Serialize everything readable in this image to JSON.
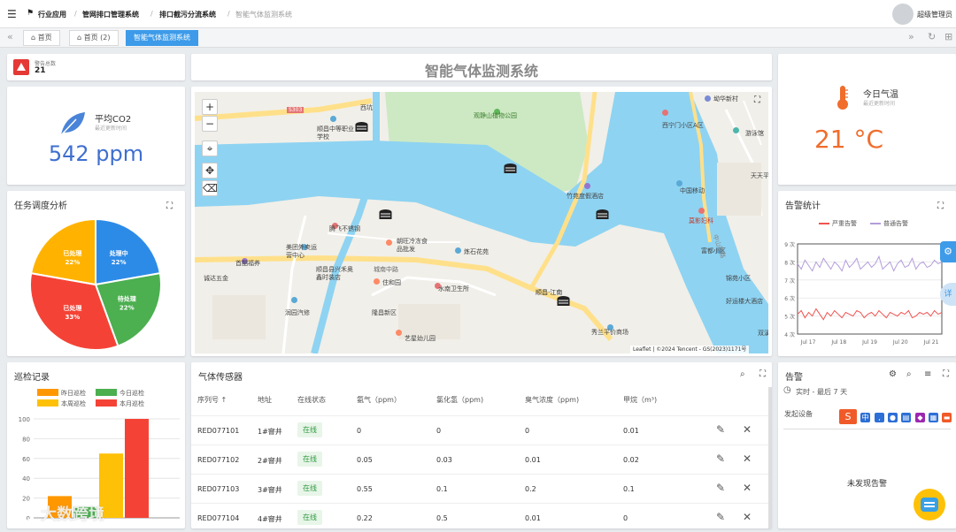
{
  "topbar": {
    "breadcrumb": [
      "行业应用",
      "管网排口管理系统",
      "排口截污分流系统",
      "智能气体监测系统"
    ],
    "user": "超级管理员"
  },
  "tabs": [
    {
      "label": "首页",
      "active": false
    },
    {
      "label": "首页 (2)",
      "active": false
    },
    {
      "label": "智能气体监测系统",
      "active": true
    }
  ],
  "page_title": "智能气体监测系统",
  "alarm_card": {
    "label": "警告总数",
    "value": "21"
  },
  "co2_card": {
    "title": "平均CO2",
    "subtitle": "最近更新时间",
    "value": "542 ppm"
  },
  "temp_card": {
    "title": "今日气温",
    "subtitle": "最近更新时间",
    "value": "21 °C"
  },
  "task_card": {
    "title": "任务调度分析"
  },
  "patrol_card": {
    "title": "巡检记录"
  },
  "map": {
    "attribution": "Leaflet | ©2024 Tencent - GS(2023)1171号",
    "labels": [
      "西坑",
      "坳华新村",
      "观静山植物公园",
      "西宁门小区A区",
      "游泳馆",
      "顺昌中等职业学校",
      "天天平",
      "竹苑度假酒店",
      "中国移动",
      "莫影妇科",
      "腾飞不锈钢",
      "朝旺冷冻食品批发",
      "美团外卖运营中心",
      "首酷福养",
      "城南中路",
      "炼石花苑",
      "顺昌县兴禾奥鑫时装店",
      "富都小区",
      "锦苑小区",
      "诚达五金",
      "住和园",
      "水南卫生所",
      "润园汽修",
      "隆昌新区",
      "好运楼大酒店",
      "艺星幼儿园",
      "秀兰平价商场",
      "双溪",
      "顺昌·江南",
      "中山西路",
      "S303"
    ]
  },
  "alarm_stats": {
    "title": "告警统计",
    "legend": [
      "严重告警",
      "普通告警"
    ]
  },
  "gas_sensor": {
    "title": "气体传感器",
    "columns": [
      "序列号",
      "地址",
      "在线状态",
      "氨气（ppm）",
      "氯化氢（ppm)",
      "臭气浓度（ppm)",
      "甲烷（m³)"
    ],
    "rows": [
      [
        "RED077101",
        "1#窨井",
        "在线",
        "0",
        "0",
        "0",
        "0.01"
      ],
      [
        "RED077102",
        "2#窨井",
        "在线",
        "0.05",
        "0.03",
        "0.01",
        "0.02"
      ],
      [
        "RED077103",
        "3#窨井",
        "在线",
        "0.55",
        "0.1",
        "0.2",
        "0.1"
      ],
      [
        "RED077104",
        "4#窨井",
        "在线",
        "0.22",
        "0.5",
        "0.01",
        "0"
      ]
    ]
  },
  "alarm_panel": {
    "title": "告警",
    "time_range": "实时 - 最后 7 天",
    "device_label": "发起设备",
    "empty_text": "未发现告警"
  },
  "side_buttons": [
    "详"
  ],
  "watermark": "大数跨境",
  "chart_data": [
    {
      "type": "pie",
      "title": "任务调度分析",
      "categories": [
        "处理中",
        "待处理",
        "已处理",
        "已处理"
      ],
      "values": [
        22,
        22,
        33,
        22
      ],
      "labels": [
        "处理中\n22%",
        "待处理\n22%",
        "已处理\n33%",
        "已处理\n22%"
      ],
      "colors": [
        "#2d8be8",
        "#4caf50",
        "#f44336",
        "#ffb300"
      ]
    },
    {
      "type": "bar",
      "title": "巡检记录",
      "categories": [
        ""
      ],
      "series": [
        {
          "name": "昨日巡检",
          "values": [
            22
          ],
          "color": "#ff9800"
        },
        {
          "name": "今日巡检",
          "values": [
            11
          ],
          "color": "#4caf50"
        },
        {
          "name": "本周巡检",
          "values": [
            65
          ],
          "color": "#ffc107"
        },
        {
          "name": "本月巡检",
          "values": [
            100
          ],
          "color": "#f44336"
        }
      ],
      "ylim": [
        0,
        100
      ],
      "yticks": [
        "0",
        "20",
        "40",
        "60",
        "80",
        "100"
      ],
      "grid": true,
      "legend_position": "top"
    },
    {
      "type": "line",
      "title": "告警统计",
      "x": [
        "Jul 17",
        "Jul 18",
        "Jul 19",
        "Jul 20",
        "Jul 21"
      ],
      "ylim": [
        4,
        9
      ],
      "yticks": [
        "4 次",
        "5 次",
        "6 次",
        "7 次",
        "8 次",
        "9 次"
      ],
      "series": [
        {
          "name": "严重告警",
          "color": "#ef5350",
          "values": [
            5.1,
            5.3,
            4.9,
            5.2,
            5.0,
            5.4,
            5.1,
            4.8,
            5.2,
            5.0,
            5.3,
            5.1,
            4.9,
            5.2,
            5.1,
            5.0,
            5.3,
            5.2,
            4.9,
            5.1,
            5.2,
            5.0,
            5.3,
            5.1,
            4.9,
            5.2,
            5.1,
            5.0,
            5.2,
            5.1,
            5.3,
            4.9,
            5.0,
            5.2,
            5.1,
            5.2,
            5.0,
            5.3,
            5.1,
            5.2
          ]
        },
        {
          "name": "普通告警",
          "color": "#b39ddb",
          "values": [
            7.9,
            7.6,
            8.1,
            7.8,
            7.5,
            8.0,
            7.7,
            8.2,
            7.9,
            7.6,
            8.0,
            7.8,
            7.5,
            8.1,
            7.7,
            7.9,
            8.2,
            7.6,
            7.8,
            8.0,
            7.7,
            7.9,
            8.3,
            7.6,
            7.8,
            8.0,
            7.5,
            7.9,
            8.1,
            7.7,
            7.8,
            8.2,
            7.6,
            7.9,
            8.0,
            7.7,
            7.8,
            8.1,
            7.9,
            8.0
          ]
        }
      ]
    }
  ]
}
